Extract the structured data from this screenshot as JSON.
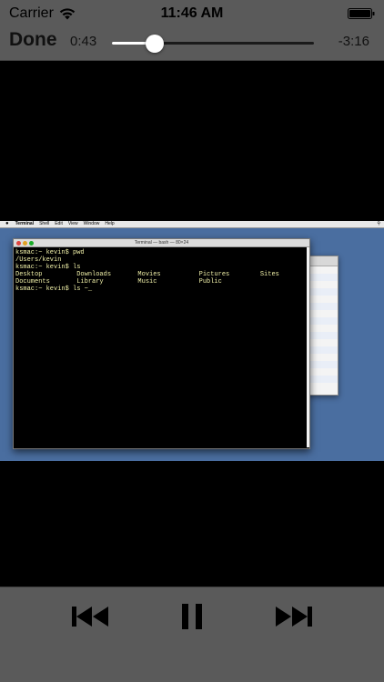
{
  "status_bar": {
    "carrier": "Carrier",
    "time": "11:46 AM",
    "wifi_icon": "wifi-icon",
    "battery_icon": "battery-icon"
  },
  "player": {
    "done_label": "Done",
    "elapsed": "0:43",
    "remaining": "-3:16",
    "progress": 0.21
  },
  "video": {
    "menubar": {
      "apple_icon": "apple-icon",
      "items": [
        "Terminal",
        "Shell",
        "Edit",
        "View",
        "Window",
        "Help"
      ],
      "search_icon": "spotlight-icon"
    },
    "terminal": {
      "title": "Terminal — bash — 80×24",
      "lines": [
        "ksmac:~ kevin$ pwd",
        "/Users/kevin",
        "ksmac:~ kevin$ ls",
        "Desktop         Downloads       Movies          Pictures        Sites",
        "Documents       Library         Music           Public",
        "ksmac:~ kevin$ ls ~_"
      ]
    }
  },
  "transport": {
    "rewind_icon": "rewind-icon",
    "pause_icon": "pause-icon",
    "forward_icon": "fast-forward-icon"
  },
  "colors": {
    "bar_background": "#5a5a5a",
    "desktop_background": "#4a6ea0",
    "terminal_text": "#f0f0a8"
  }
}
